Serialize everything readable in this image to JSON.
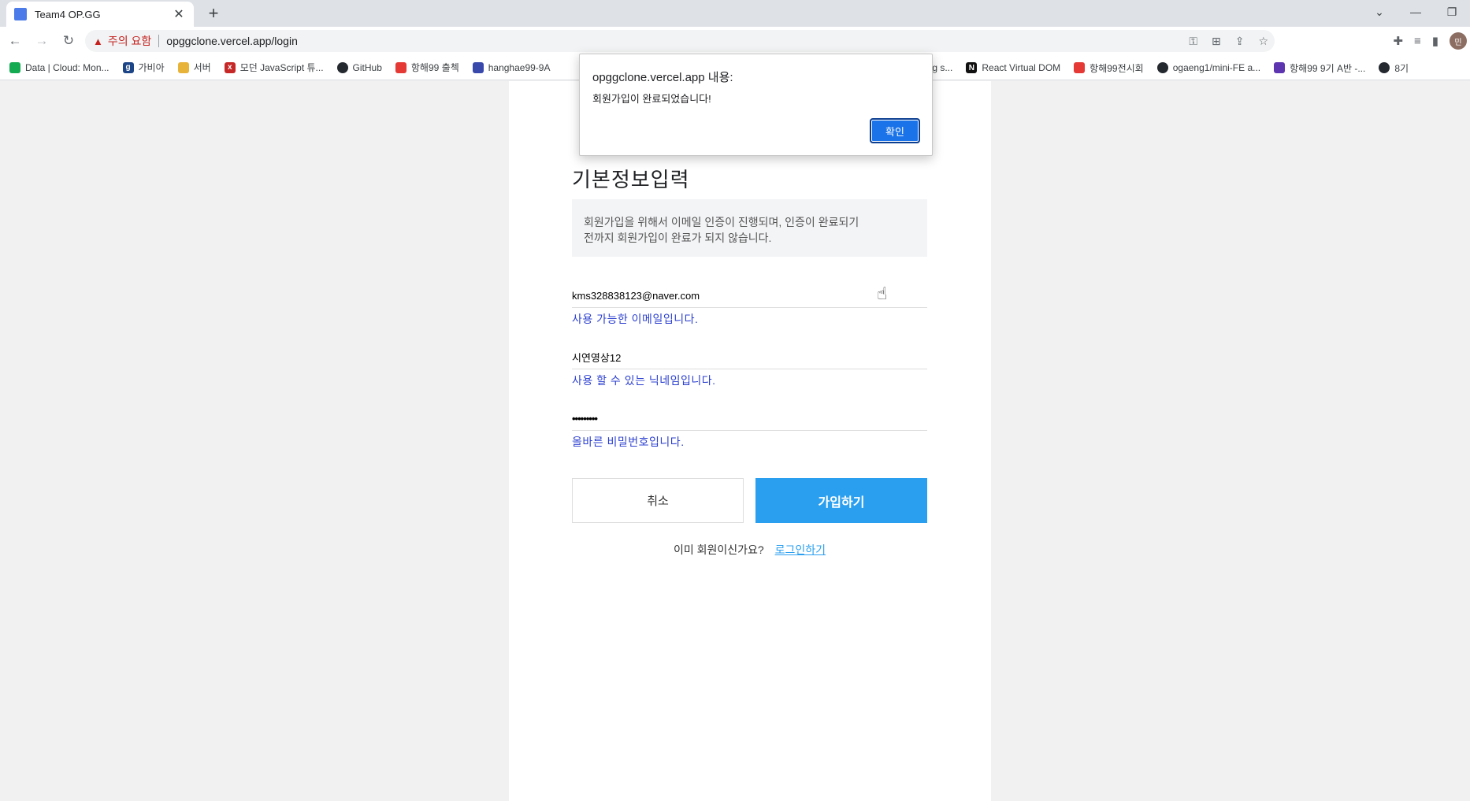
{
  "browser": {
    "tab_title": "Team4 OP.GG",
    "tab_close": "✕",
    "new_tab": "+",
    "security_warning": "주의 요함",
    "url": "opggclone.vercel.app/login",
    "bookmarks": [
      {
        "label": "Data | Cloud: Mon...",
        "icon": "mongodb-leaf-icon",
        "color": "#13aa52"
      },
      {
        "label": "가비아",
        "icon": "gabia-icon",
        "color": "#1c4587"
      },
      {
        "label": "서버",
        "icon": "folder-box-icon",
        "color": "#e8b339"
      },
      {
        "label": "모던 JavaScript 튜...",
        "icon": "javascript-info-icon",
        "color": "#c62828"
      },
      {
        "label": "GitHub",
        "icon": "github-icon",
        "color": "#24292f"
      },
      {
        "label": "항해99 출첵",
        "icon": "hanghae-icon",
        "color": "#e53935"
      },
      {
        "label": "hanghae99-9A",
        "icon": "notion-icon",
        "color": "#3949ab"
      }
    ],
    "bookmarks_right": [
      {
        "label": "ing s...",
        "icon": "",
        "color": ""
      },
      {
        "label": "React Virtual DOM",
        "icon": "notion-icon",
        "color": "#111111"
      },
      {
        "label": "항해99전시회",
        "icon": "hanghae-icon",
        "color": "#e53935"
      },
      {
        "label": "ogaeng1/mini-FE a...",
        "icon": "github-icon",
        "color": "#24292f"
      },
      {
        "label": "항해99 9기 A반 -...",
        "icon": "stack-icon",
        "color": "#5e35b1"
      },
      {
        "label": "8기",
        "icon": "github-icon",
        "color": "#24292f"
      }
    ]
  },
  "signup": {
    "heading": "기본정보입력",
    "notice_line1": "회원가입을 위해서 이메일 인증이 진행되며, 인증이 완료되기",
    "notice_line2": "전까지 회원가입이 완료가 되지 않습니다.",
    "email_value": "kms328838123@naver.com",
    "email_hint": "사용 가능한 이메일입니다.",
    "nickname_value": "시연영상12",
    "nickname_hint": "사용 할 수 있는 닉네임입니다.",
    "password_value": "•••••••••",
    "password_hint": "올바른 비밀번호입니다.",
    "cancel_label": "취소",
    "signup_label": "가입하기",
    "already_member": "이미 회원이신가요?",
    "login_link": "로그인하기"
  },
  "alert": {
    "title": "opggclone.vercel.app 내용:",
    "message": "회원가입이 완료되었습니다!",
    "ok_label": "확인"
  },
  "colors": {
    "accent": "#2a9ff0",
    "hint_text": "#2b3fcf",
    "dialog_button": "#1a73e8",
    "warning": "#c5221f"
  }
}
